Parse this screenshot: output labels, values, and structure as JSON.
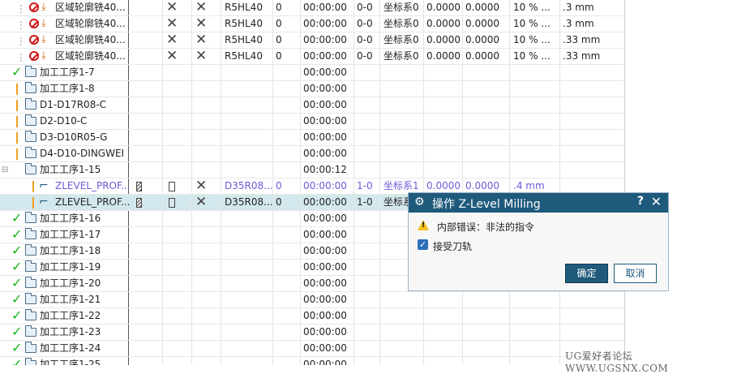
{
  "rows": [
    {
      "kind": "region",
      "name": "区域轮廓铣40...",
      "tool": "R5HL40",
      "n": "0",
      "time": "00:00:00",
      "p": "0-0",
      "csys": "坐标系0",
      "a": "0.0000",
      "b": "0.0000",
      "pct": "10 % ...",
      "tol": ".3 mm"
    },
    {
      "kind": "region",
      "name": "区域轮廓铣40...",
      "tool": "R5HL40",
      "n": "0",
      "time": "00:00:00",
      "p": "0-0",
      "csys": "坐标系0",
      "a": "0.0000",
      "b": "0.0000",
      "pct": "10 % ...",
      "tol": ".3 mm"
    },
    {
      "kind": "region",
      "name": "区域轮廓铣40...",
      "tool": "R5HL40",
      "n": "0",
      "time": "00:00:00",
      "p": "0-0",
      "csys": "坐标系0",
      "a": "0.0000",
      "b": "0.0000",
      "pct": "10 % ...",
      "tol": ".33 mm"
    },
    {
      "kind": "region",
      "name": "区域轮廓铣40...",
      "tool": "R5HL40",
      "n": "0",
      "time": "00:00:00",
      "p": "0-0",
      "csys": "坐标系0",
      "a": "0.0000",
      "b": "0.0000",
      "pct": "10 % ...",
      "tol": ".33 mm"
    },
    {
      "kind": "group-ok",
      "name": "加工工序1-7",
      "time": "00:00:00"
    },
    {
      "kind": "group-warn",
      "name": "加工工序1-8",
      "time": "00:00:00"
    },
    {
      "kind": "group-warn",
      "name": "D1-D17R08-C",
      "time": "00:00:00"
    },
    {
      "kind": "group-warn",
      "name": "D2-D10-C",
      "time": "00:00:00"
    },
    {
      "kind": "group-warn",
      "name": "D3-D10R05-G",
      "time": "00:00:00"
    },
    {
      "kind": "group-warn",
      "name": "D4-D10-DINGWEI",
      "time": "00:00:00"
    },
    {
      "kind": "group-exp",
      "name": "加工工序1-15",
      "time": "00:00:12"
    },
    {
      "kind": "zlevel1",
      "name": "ZLEVEL_PROF...",
      "tool": "D35R08...",
      "n": "0",
      "time": "00:00:00",
      "p": "1-0",
      "csys": "坐标系1",
      "a": "0.0000",
      "b": "0.0000",
      "tol": ".4 mm"
    },
    {
      "kind": "zlevel2",
      "name": "ZLEVEL_PROF...",
      "tool": "D35R08...",
      "n": "0",
      "time": "00:00:00",
      "p": "1-0",
      "csys": "坐标系"
    },
    {
      "kind": "group-ok",
      "name": "加工工序1-16",
      "time": "00:00:00"
    },
    {
      "kind": "group-ok",
      "name": "加工工序1-17",
      "time": "00:00:00"
    },
    {
      "kind": "group-ok",
      "name": "加工工序1-18",
      "time": "00:00:00"
    },
    {
      "kind": "group-ok",
      "name": "加工工序1-19",
      "time": "00:00:00"
    },
    {
      "kind": "group-ok",
      "name": "加工工序1-20",
      "time": "00:00:00"
    },
    {
      "kind": "group-ok",
      "name": "加工工序1-21",
      "time": "00:00:00"
    },
    {
      "kind": "group-ok",
      "name": "加工工序1-22",
      "time": "00:00:00"
    },
    {
      "kind": "group-ok",
      "name": "加工工序1-23",
      "time": "00:00:00"
    },
    {
      "kind": "group-ok",
      "name": "加工工序1-24",
      "time": "00:00:00"
    },
    {
      "kind": "group-ok",
      "name": "加工工序1-25",
      "time": "00:00:00"
    }
  ],
  "dialog": {
    "title": "操作  Z-Level Milling",
    "help": "?",
    "close": "✕",
    "message": "内部错误：非法的指令",
    "checkbox_label": "接受刀轨",
    "ok": "确定",
    "cancel": "取消"
  },
  "watermark": "UG爱好者论坛 WWW.UGSNX.COM"
}
